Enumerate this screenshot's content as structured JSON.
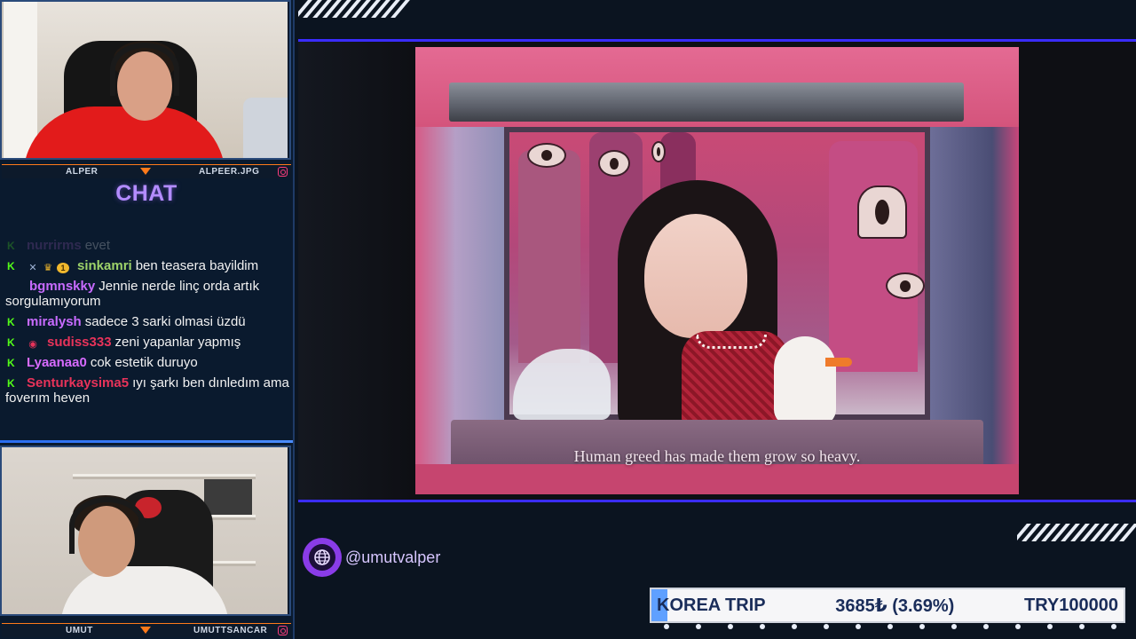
{
  "colors": {
    "chat_title": "#b38cff",
    "accent_orange": "#ff7a1a",
    "accent_blue": "#3a2cff",
    "kick_green": "#53fc18"
  },
  "cams": {
    "top": {
      "name": "ALPER",
      "handle": "ALPEER.JPG"
    },
    "bottom": {
      "name": "UMUT",
      "handle": "UMUTTSANCAR"
    }
  },
  "chat": {
    "title": "CHAT",
    "messages": [
      {
        "user": "nurrirms",
        "text": "evet",
        "color": "#9b59b6"
      },
      {
        "user": "sinkamri",
        "text": "ben teasera bayildim",
        "color": "#9ed36a",
        "badges": [
          "sword-icon",
          "crown-icon",
          "sub-badge-icon"
        ],
        "sub_badge": "1"
      },
      {
        "user": "bgmnskky",
        "text": "Jennie nerde linç orda artık sorgulamıyorum",
        "color": "#c86bff"
      },
      {
        "user": "miralysh",
        "text": "sadece 3 sarki olmasi üzdü",
        "color": "#c86bff"
      },
      {
        "user": "sudiss333",
        "text": "zeni yapanlar yapmış",
        "color": "#e8335a",
        "badges": [
          "shield-icon"
        ]
      },
      {
        "user": "Lyaanaa0",
        "text": "cok estetik duruyo",
        "color": "#d86bff"
      },
      {
        "user": "Senturkaysima5",
        "text": "ıyı şarkı ben dınledım ama foverım heven",
        "color": "#e8335a"
      }
    ]
  },
  "video": {
    "subtitle": "Human greed has made them grow so heavy."
  },
  "social": {
    "handle": "@umutvalper",
    "icon": "globe-icon"
  },
  "ticker": {
    "label": "KOREA TRIP",
    "progress": "3685₺ (3.69%)",
    "goal": "TRY100000",
    "progress_fraction": 0.0369
  }
}
